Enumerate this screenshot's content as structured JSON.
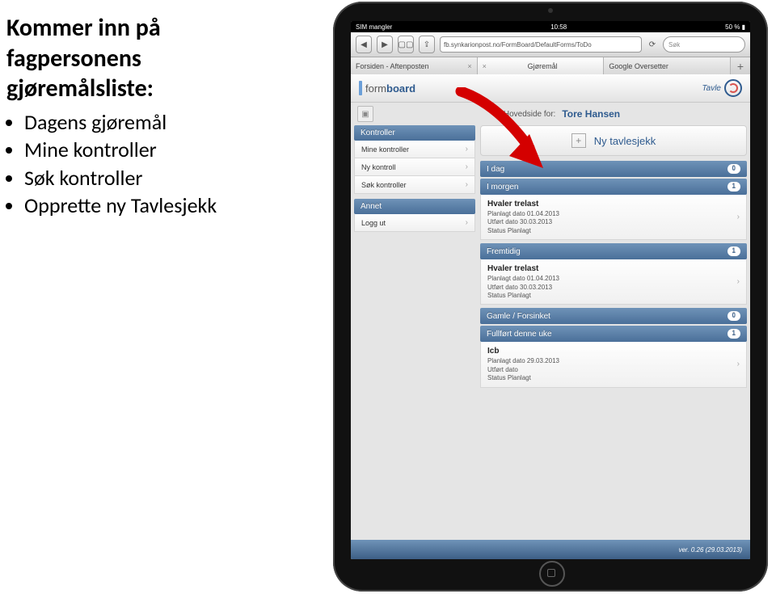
{
  "side": {
    "line1": "Kommer inn på",
    "line2": "fagpersonens",
    "line3": "gjøremålsliste:",
    "items": [
      "Dagens gjøremål",
      "Mine kontroller",
      "Søk kontroller",
      "Opprette ny Tavlesjekk"
    ]
  },
  "status": {
    "left": "SIM mangler",
    "center": "10:58",
    "right": "50 % ▮"
  },
  "toolbar": {
    "back": "◀",
    "fwd": "▶",
    "book": "▢▢",
    "share": "⇪",
    "url": "fb.synkarionpost.no/FormBoard/DefaultForms/ToDo",
    "reload": "⟳",
    "search_placeholder": "Søk"
  },
  "tabs": [
    {
      "label": "Forsiden - Aftenposten",
      "has_close": true,
      "active": false
    },
    {
      "label": "Gjøremål",
      "has_close": true,
      "active": true
    },
    {
      "label": "Google Oversetter",
      "has_close": false,
      "active": false
    }
  ],
  "brand": {
    "form": "form",
    "board": "board",
    "tavle": "Tavle"
  },
  "subhead": {
    "label": "Hovedside for:",
    "name": "Tore Hansen"
  },
  "left_sections": [
    {
      "header": "Kontroller",
      "rows": [
        "Mine kontroller",
        "Ny kontroll",
        "Søk kontroller"
      ]
    },
    {
      "header": "Annet",
      "rows": [
        "Logg ut"
      ]
    }
  ],
  "right": {
    "big_button": "Ny tavlesjekk",
    "groups": [
      {
        "header": "I dag",
        "count": "0",
        "items": []
      },
      {
        "header": "I morgen",
        "count": "1",
        "items": [
          {
            "title": "Hvaler trelast",
            "planlagt": "Planlagt dato 01.04.2013",
            "utfort": "Utført dato 30.03.2013",
            "status": "Status Planlagt"
          }
        ]
      },
      {
        "header": "Fremtidig",
        "count": "1",
        "items": [
          {
            "title": "Hvaler trelast",
            "planlagt": "Planlagt dato 01.04.2013",
            "utfort": "Utført dato 30.03.2013",
            "status": "Status Planlagt"
          }
        ]
      },
      {
        "header": "Gamle / Forsinket",
        "count": "0",
        "items": []
      },
      {
        "header": "Fullført denne uke",
        "count": "1",
        "items": [
          {
            "title": "Icb",
            "planlagt": "Planlagt dato 29.03.2013",
            "utfort": "Utført dato",
            "status": "Status Planlagt"
          }
        ]
      }
    ]
  },
  "footer": "ver. 0.26 (29.03.2013)"
}
